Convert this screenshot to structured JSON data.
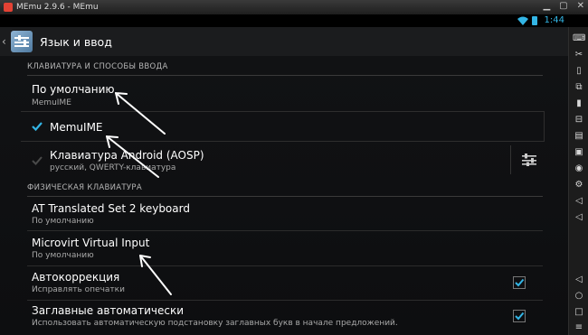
{
  "window": {
    "title": "MEmu 2.9.6 - MEmu"
  },
  "status": {
    "time": "1:44"
  },
  "header": {
    "title": "Язык и ввод"
  },
  "sections": {
    "keyboards": "КЛАВИАТУРА И СПОСОБЫ ВВОДА",
    "physical": "ФИЗИЧЕСКАЯ КЛАВИАТУРА"
  },
  "items": {
    "default": {
      "title": "По умолчанию",
      "subtitle": "MemuIME"
    },
    "memuime": {
      "title": "MemuIME",
      "checked": true
    },
    "aosp": {
      "title": "Клавиатура Android (AOSP)",
      "subtitle": "русский, QWERTY-клавиатура",
      "checked": true
    },
    "at_kbd": {
      "title": "AT Translated Set 2 keyboard",
      "subtitle": "По умолчанию"
    },
    "microvirt": {
      "title": "Microvirt Virtual Input",
      "subtitle": "По умолчанию"
    },
    "autocorrect": {
      "title": "Автокоррекция",
      "subtitle": "Исправлять опечатки",
      "checked": true
    },
    "autocaps": {
      "title": "Заглавные автоматически",
      "subtitle": "Использовать автоматическую подстановку заглавных букв в начале предложений.",
      "checked": true
    }
  },
  "colors": {
    "accent": "#33b5e5",
    "background": "#111214"
  },
  "sidebar_icons": [
    "keyboard-icon",
    "scissors-icon",
    "rotate-icon",
    "screenshot-icon",
    "shake-icon",
    "toolbox-icon",
    "apk-icon",
    "folder-icon",
    "location-icon",
    "settings-icon",
    "volume-up-icon",
    "volume-down-icon",
    "back-icon",
    "home-icon",
    "recents-icon",
    "menu-icon"
  ]
}
